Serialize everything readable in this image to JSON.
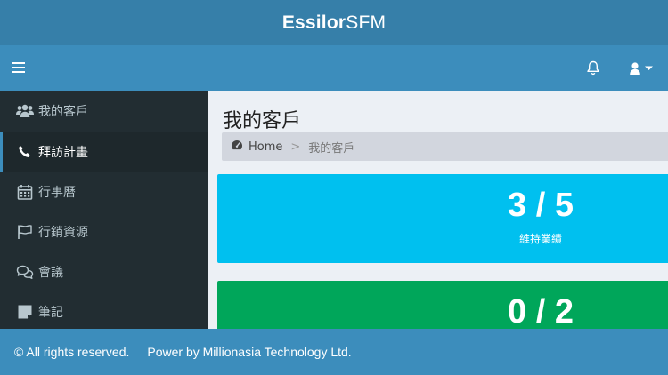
{
  "app": {
    "brand_bold": "Essilor",
    "brand_light": "SFM"
  },
  "sidebar": {
    "items": [
      {
        "label": "我的客戶",
        "icon": "users-icon"
      },
      {
        "label": "拜訪計畫",
        "icon": "phone-icon",
        "active": true
      },
      {
        "label": "行事曆",
        "icon": "calendar-icon"
      },
      {
        "label": "行銷資源",
        "icon": "flag-icon"
      },
      {
        "label": "會議",
        "icon": "comments-icon"
      },
      {
        "label": "筆記",
        "icon": "sticky-note-icon"
      }
    ]
  },
  "main": {
    "title": "我的客戶",
    "breadcrumb": {
      "home": "Home",
      "separator": ">",
      "current": "我的客戶"
    },
    "stats": [
      {
        "value": "3 / 5",
        "label": "維持業績",
        "color": "#00c0ef"
      },
      {
        "value": "0 / 2",
        "label": "",
        "color": "#00a65a"
      }
    ]
  },
  "footer": {
    "copyright": "© All rights reserved.",
    "power": "Power by Millionasia Technology Ltd."
  },
  "colors": {
    "header": "#367fa9",
    "navbar": "#3c8dbc",
    "sidebar": "#222d32",
    "content_bg": "#ecf0f5"
  }
}
